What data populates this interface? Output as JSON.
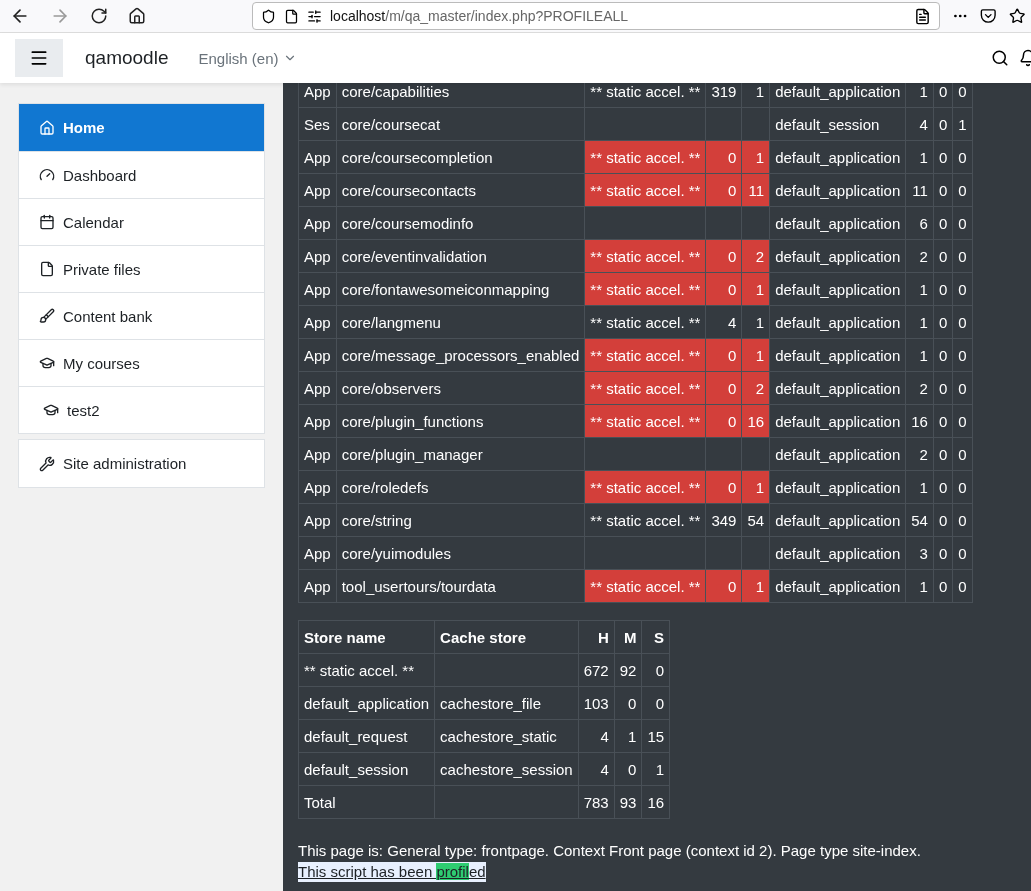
{
  "browser": {
    "url_host": "localhost",
    "url_path": "/m/qa_master/index.php?PROFILEALL"
  },
  "navbar": {
    "site_name": "qamoodle",
    "language": "English (en)"
  },
  "sidebar": {
    "items": [
      {
        "label": "Home",
        "selected": true
      },
      {
        "label": "Dashboard",
        "selected": false
      },
      {
        "label": "Calendar",
        "selected": false
      },
      {
        "label": "Private files",
        "selected": false
      },
      {
        "label": "Content bank",
        "selected": false
      },
      {
        "label": "My courses",
        "selected": false,
        "children": [
          {
            "label": "test2",
            "selected": false
          }
        ]
      },
      {
        "label": "Site administration",
        "selected": false
      }
    ]
  },
  "cache_table": {
    "rows": [
      {
        "mode": "App",
        "definition": "core/capabilities",
        "store": "** static accel. **",
        "hits": "319",
        "misses": "1",
        "warning": false,
        "store_2": "default_application",
        "hits_2": "1",
        "misses_2": "0",
        "sets_2": "0"
      },
      {
        "mode": "Ses",
        "definition": "core/coursecat",
        "store": "",
        "hits": "",
        "misses": "",
        "warning": false,
        "store_2": "default_session",
        "hits_2": "4",
        "misses_2": "0",
        "sets_2": "1"
      },
      {
        "mode": "App",
        "definition": "core/coursecompletion",
        "store": "** static accel. **",
        "hits": "0",
        "misses": "1",
        "warning": true,
        "store_2": "default_application",
        "hits_2": "1",
        "misses_2": "0",
        "sets_2": "0"
      },
      {
        "mode": "App",
        "definition": "core/coursecontacts",
        "store": "** static accel. **",
        "hits": "0",
        "misses": "11",
        "warning": true,
        "store_2": "default_application",
        "hits_2": "11",
        "misses_2": "0",
        "sets_2": "0"
      },
      {
        "mode": "App",
        "definition": "core/coursemodinfo",
        "store": "",
        "hits": "",
        "misses": "",
        "warning": false,
        "store_2": "default_application",
        "hits_2": "6",
        "misses_2": "0",
        "sets_2": "0"
      },
      {
        "mode": "App",
        "definition": "core/eventinvalidation",
        "store": "** static accel. **",
        "hits": "0",
        "misses": "2",
        "warning": true,
        "store_2": "default_application",
        "hits_2": "2",
        "misses_2": "0",
        "sets_2": "0"
      },
      {
        "mode": "App",
        "definition": "core/fontawesomeiconmapping",
        "store": "** static accel. **",
        "hits": "0",
        "misses": "1",
        "warning": true,
        "store_2": "default_application",
        "hits_2": "1",
        "misses_2": "0",
        "sets_2": "0"
      },
      {
        "mode": "App",
        "definition": "core/langmenu",
        "store": "** static accel. **",
        "hits": "4",
        "misses": "1",
        "warning": false,
        "store_2": "default_application",
        "hits_2": "1",
        "misses_2": "0",
        "sets_2": "0"
      },
      {
        "mode": "App",
        "definition": "core/message_processors_enabled",
        "store": "** static accel. **",
        "hits": "0",
        "misses": "1",
        "warning": true,
        "store_2": "default_application",
        "hits_2": "1",
        "misses_2": "0",
        "sets_2": "0"
      },
      {
        "mode": "App",
        "definition": "core/observers",
        "store": "** static accel. **",
        "hits": "0",
        "misses": "2",
        "warning": true,
        "store_2": "default_application",
        "hits_2": "2",
        "misses_2": "0",
        "sets_2": "0"
      },
      {
        "mode": "App",
        "definition": "core/plugin_functions",
        "store": "** static accel. **",
        "hits": "0",
        "misses": "16",
        "warning": true,
        "store_2": "default_application",
        "hits_2": "16",
        "misses_2": "0",
        "sets_2": "0"
      },
      {
        "mode": "App",
        "definition": "core/plugin_manager",
        "store": "",
        "hits": "",
        "misses": "",
        "warning": false,
        "store_2": "default_application",
        "hits_2": "2",
        "misses_2": "0",
        "sets_2": "0"
      },
      {
        "mode": "App",
        "definition": "core/roledefs",
        "store": "** static accel. **",
        "hits": "0",
        "misses": "1",
        "warning": true,
        "store_2": "default_application",
        "hits_2": "1",
        "misses_2": "0",
        "sets_2": "0"
      },
      {
        "mode": "App",
        "definition": "core/string",
        "store": "** static accel. **",
        "hits": "349",
        "misses": "54",
        "warning": false,
        "store_2": "default_application",
        "hits_2": "54",
        "misses_2": "0",
        "sets_2": "0"
      },
      {
        "mode": "App",
        "definition": "core/yuimodules",
        "store": "",
        "hits": "",
        "misses": "",
        "warning": false,
        "store_2": "default_application",
        "hits_2": "3",
        "misses_2": "0",
        "sets_2": "0"
      },
      {
        "mode": "App",
        "definition": "tool_usertours/tourdata",
        "store": "** static accel. **",
        "hits": "0",
        "misses": "1",
        "warning": true,
        "store_2": "default_application",
        "hits_2": "1",
        "misses_2": "0",
        "sets_2": "0"
      }
    ]
  },
  "store_table": {
    "columns": [
      "Store name",
      "Cache store",
      "H",
      "M",
      "S"
    ],
    "rows": [
      [
        "** static accel. **",
        "",
        "672",
        "92",
        "0"
      ],
      [
        "default_application",
        "cachestore_file",
        "103",
        "0",
        "0"
      ],
      [
        "default_request",
        "cachestore_static",
        "4",
        "1",
        "15"
      ],
      [
        "default_session",
        "cachestore_session",
        "4",
        "0",
        "1"
      ],
      [
        "Total",
        "",
        "783",
        "93",
        "16"
      ]
    ]
  },
  "page_info": "This page is: General type: frontpage. Context Front page (context id 2). Page type site-index.",
  "profiled_link": {
    "parts": [
      {
        "text": "This script has been ",
        "highlighted": false
      },
      {
        "text": "profil",
        "highlighted": true
      },
      {
        "text": "ed",
        "highlighted": false
      }
    ]
  }
}
